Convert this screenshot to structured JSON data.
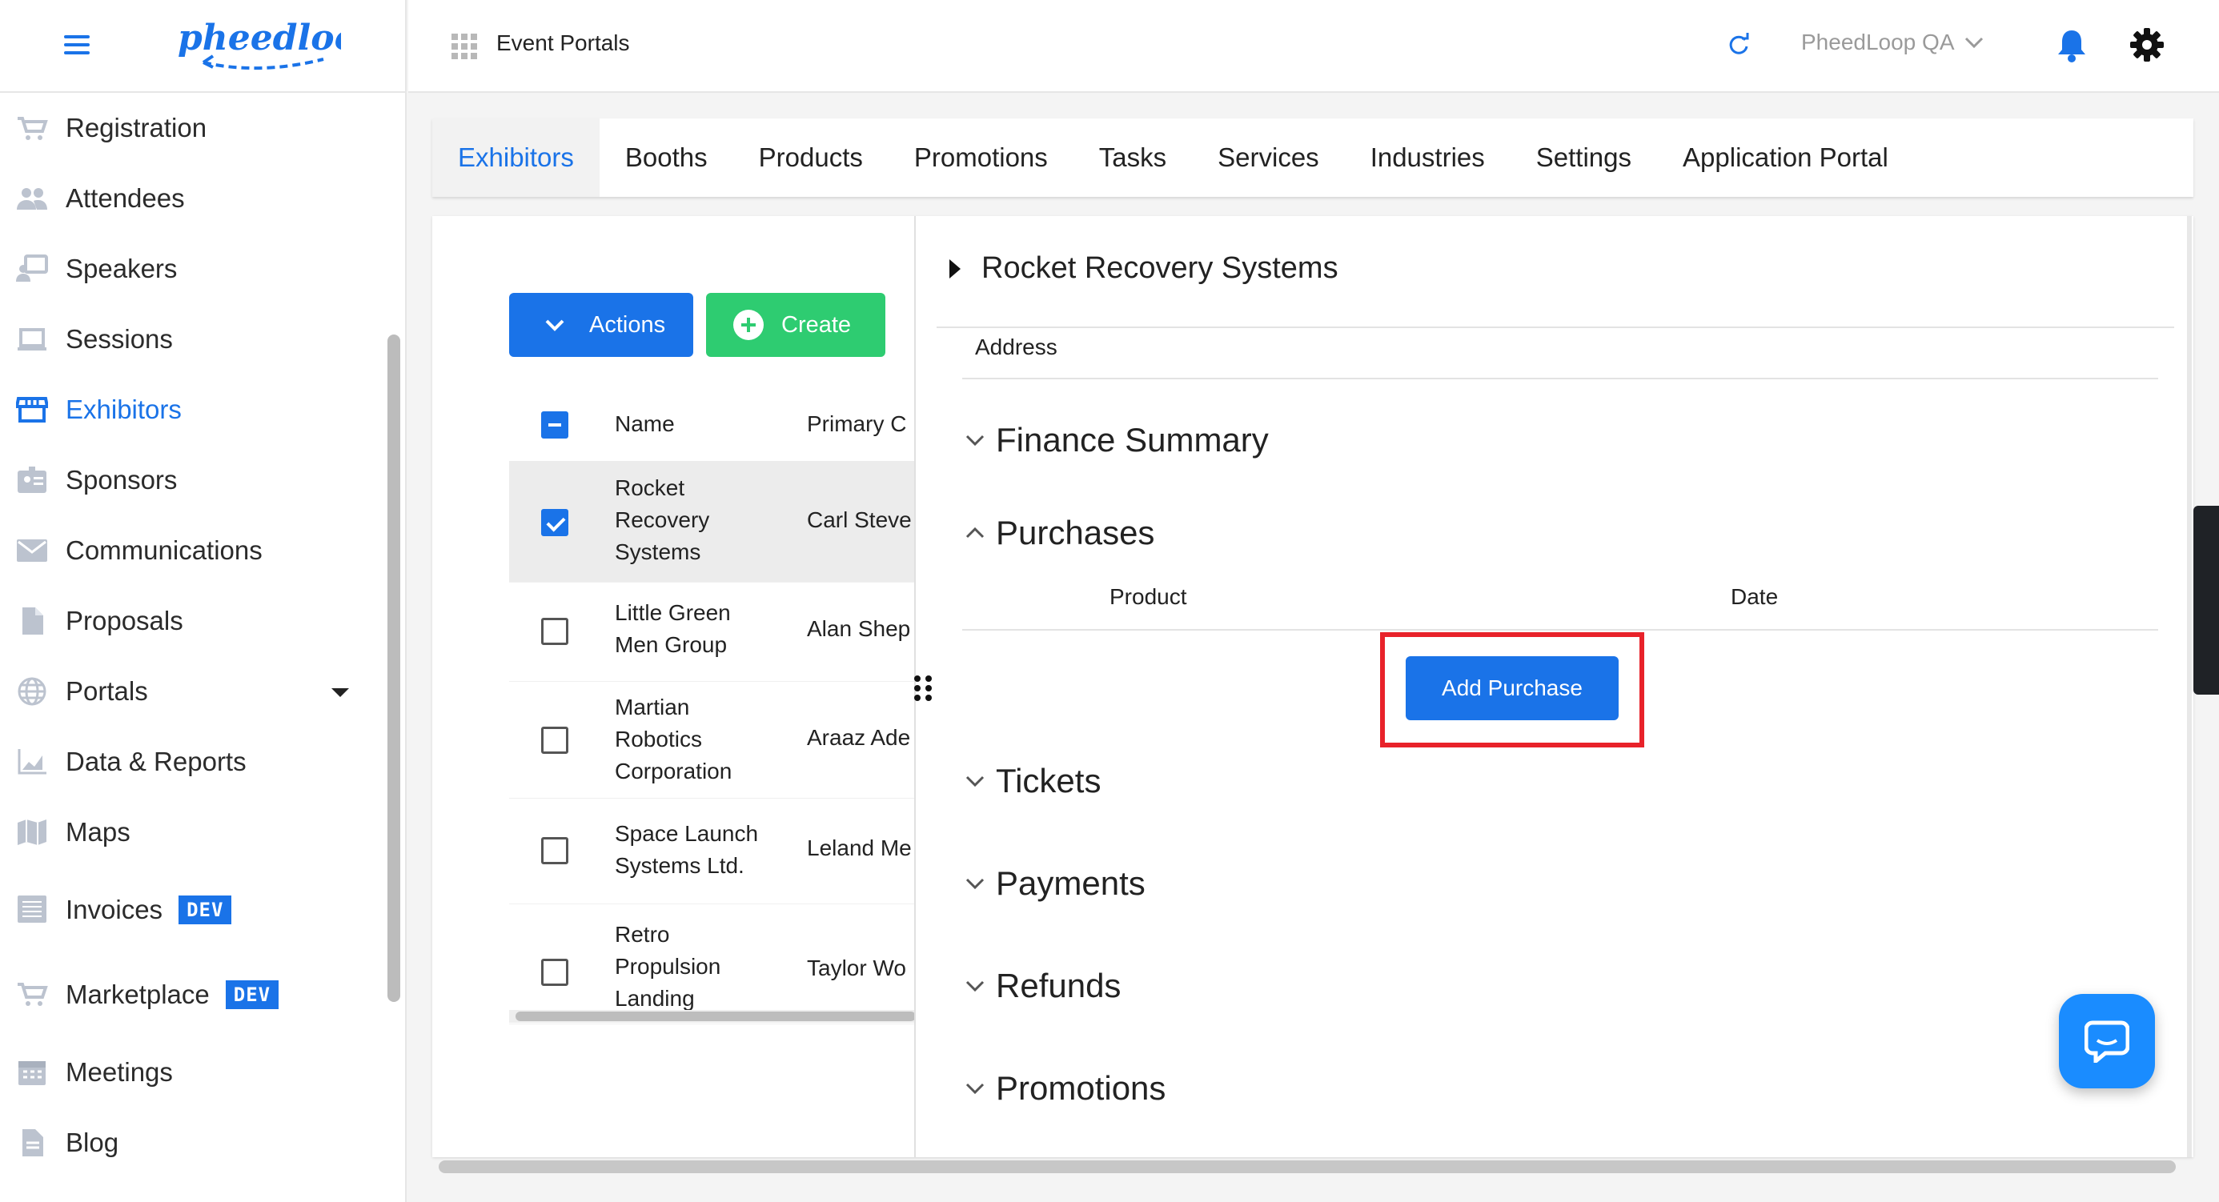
{
  "app": {
    "logo_text": "pheedloop"
  },
  "header": {
    "title": "Event Portals",
    "org_name": "PheedLoop QA"
  },
  "sidebar": {
    "items": [
      {
        "label": "Registration",
        "icon": "cart-icon"
      },
      {
        "label": "Attendees",
        "icon": "people-icon"
      },
      {
        "label": "Speakers",
        "icon": "presenter-icon"
      },
      {
        "label": "Sessions",
        "icon": "laptop-icon"
      },
      {
        "label": "Exhibitors",
        "icon": "store-icon",
        "active": true
      },
      {
        "label": "Sponsors",
        "icon": "badge-icon"
      },
      {
        "label": "Communications",
        "icon": "mail-icon"
      },
      {
        "label": "Proposals",
        "icon": "document-icon"
      },
      {
        "label": "Portals",
        "icon": "globe-icon"
      },
      {
        "label": "Data & Reports",
        "icon": "chart-icon"
      },
      {
        "label": "Maps",
        "icon": "map-icon"
      },
      {
        "label": "Invoices",
        "icon": "invoice-icon",
        "badge": "DEV"
      },
      {
        "label": "Marketplace",
        "icon": "cart-icon",
        "badge": "DEV"
      },
      {
        "label": "Meetings",
        "icon": "calendar-icon"
      },
      {
        "label": "Blog",
        "icon": "document-icon"
      }
    ]
  },
  "tabs": [
    "Exhibitors",
    "Booths",
    "Products",
    "Promotions",
    "Tasks",
    "Services",
    "Industries",
    "Settings",
    "Application Portal"
  ],
  "list": {
    "actions_label": "Actions",
    "create_label": "Create",
    "columns": [
      "Name",
      "Primary C"
    ],
    "rows": [
      {
        "name": [
          "Rocket",
          "Recovery",
          "Systems"
        ],
        "contact": "Carl Steve",
        "checked": true
      },
      {
        "name": [
          "Little Green",
          "Men Group"
        ],
        "contact": "Alan Shep",
        "checked": false
      },
      {
        "name": [
          "Martian",
          "Robotics",
          "Corporation"
        ],
        "contact": "Araaz Ade",
        "checked": false
      },
      {
        "name": [
          "Space Launch",
          "Systems Ltd."
        ],
        "contact": "Leland Me",
        "checked": false
      },
      {
        "name": [
          "Retro",
          "Propulsion",
          "Landing"
        ],
        "contact": "Taylor Wo",
        "checked": false
      }
    ]
  },
  "detail": {
    "title": "Rocket Recovery Systems",
    "address_label": "Address",
    "sections": {
      "finance": "Finance Summary",
      "purchases": "Purchases",
      "tickets": "Tickets",
      "payments": "Payments",
      "refunds": "Refunds",
      "promotions": "Promotions"
    },
    "purchases_columns": {
      "product": "Product",
      "date": "Date"
    },
    "add_purchase_label": "Add Purchase"
  },
  "colors": {
    "accent": "#1a73e8",
    "create_green": "#2ecc71",
    "highlight_red": "#e8222a"
  }
}
